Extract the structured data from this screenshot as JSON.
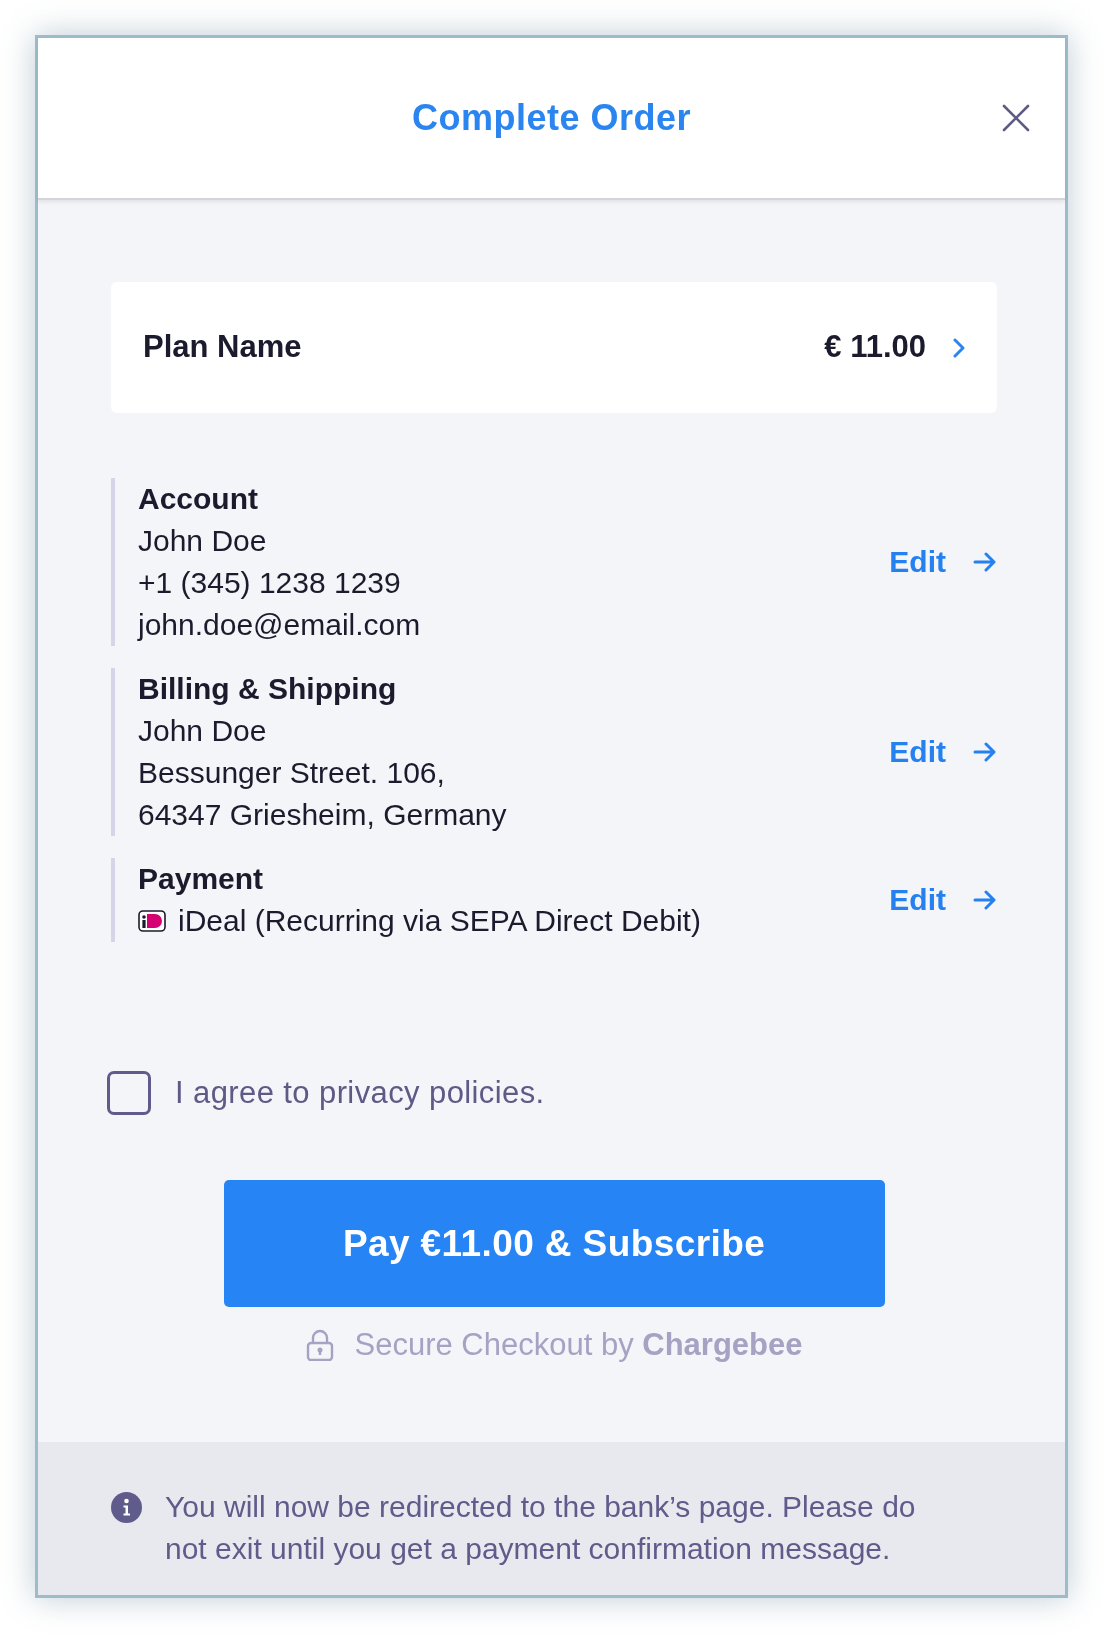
{
  "dialog": {
    "title": "Complete Order"
  },
  "plan": {
    "name": "Plan Name",
    "price": "€ 11.00"
  },
  "sections": [
    {
      "heading": "Account",
      "lines": [
        "John Doe",
        "+1 (345) 1238 1239",
        "john.doe@email.com"
      ],
      "action": "Edit"
    },
    {
      "heading": "Billing & Shipping",
      "lines": [
        "John Doe",
        "Bessunger Street. 106,",
        "64347 Griesheim, Germany"
      ],
      "action": "Edit"
    },
    {
      "heading": "Payment",
      "payment_method": "iDeal (Recurring via SEPA Direct Debit)",
      "action": "Edit"
    }
  ],
  "agreement": {
    "label": "I agree to privacy policies.",
    "checked": false
  },
  "pay_button": "Pay €11.00 & Subscribe",
  "secure_note": "Secure Checkout by **Chargebee**",
  "notice": "You will now be redirected to the bank’s page. Please do not exit until you get a payment confirmation message."
}
